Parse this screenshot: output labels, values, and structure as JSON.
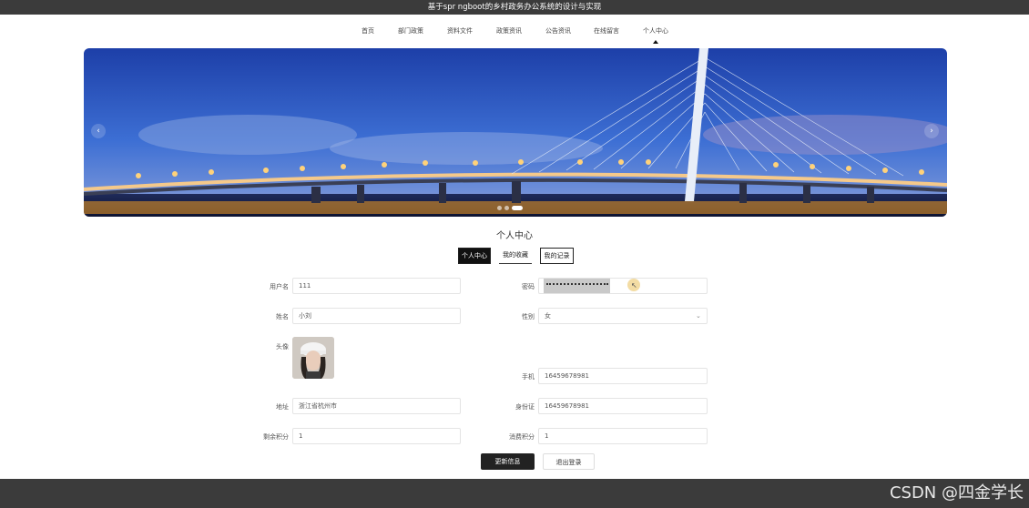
{
  "header": {
    "title": "基于spr ngboot的乡村政务办公系统的设计与实现"
  },
  "nav": {
    "items": [
      {
        "label": "首页"
      },
      {
        "label": "部门政策"
      },
      {
        "label": "资料文件"
      },
      {
        "label": "政策资讯"
      },
      {
        "label": "公告资讯"
      },
      {
        "label": "在线留言"
      },
      {
        "label": "个人中心"
      }
    ],
    "active_index": 6
  },
  "carousel": {
    "prev_label": "‹",
    "next_label": "›",
    "slide_count": 3,
    "active_slide": 2
  },
  "profile": {
    "title": "个人中心",
    "tabs": [
      {
        "label": "个人中心"
      },
      {
        "label": "我的收藏"
      },
      {
        "label": "我的记录"
      }
    ],
    "fields": {
      "username": {
        "label": "用户名",
        "value": "111"
      },
      "password": {
        "label": "密码",
        "value": "••••••••••••••••••••••••••••"
      },
      "name": {
        "label": "姓名",
        "value": "小刘"
      },
      "gender": {
        "label": "性别",
        "value": "女"
      },
      "avatar": {
        "label": "头像"
      },
      "phone": {
        "label": "手机",
        "value": "16459678981"
      },
      "address": {
        "label": "地址",
        "value": "浙江省杭州市"
      },
      "id_number": {
        "label": "身份证",
        "value": "16459678981"
      },
      "field5": {
        "label": "剩余积分",
        "value": "1"
      },
      "field6": {
        "label": "消费积分",
        "value": "1"
      }
    },
    "buttons": {
      "update": "更新信息",
      "logout": "退出登录"
    }
  },
  "watermark": "CSDN @四金学长",
  "colors": {
    "topbar": "#3b3b3b",
    "footer": "#3b3b3b",
    "accent": "#111111"
  }
}
